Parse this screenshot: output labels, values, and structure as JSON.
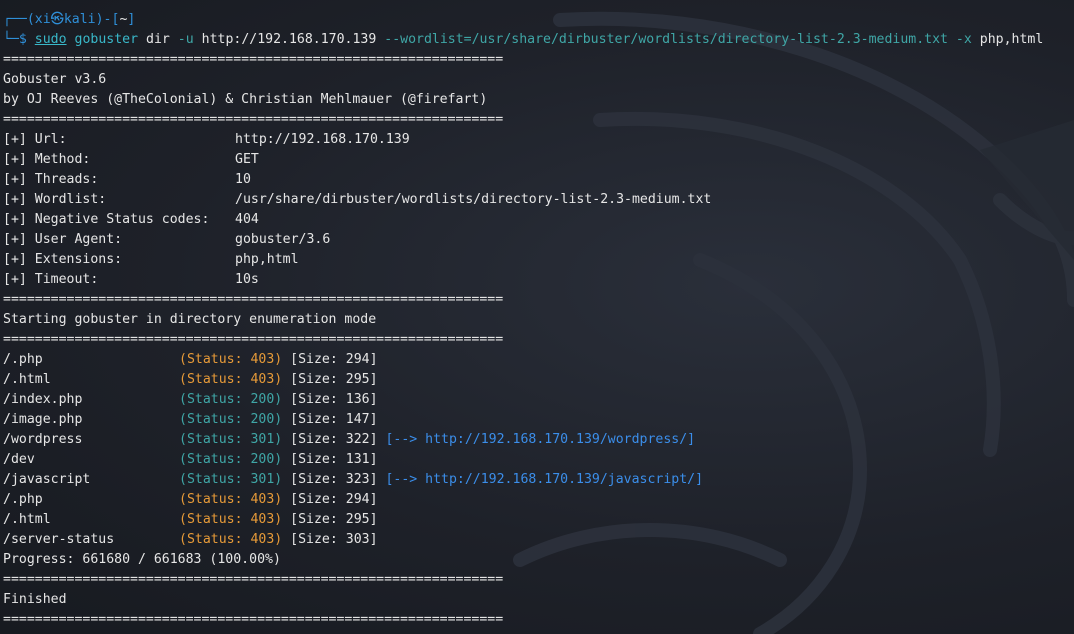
{
  "prompt": {
    "corner_top": "┌──(",
    "user": "xi",
    "skull_glyph": "㉿",
    "host": "kali",
    "sep": ")-[",
    "dir": "~",
    "close": "]",
    "corner_bottom": "└─",
    "dollar": "$",
    "command_sudo": "sudo",
    "command_gobuster": "gobuster",
    "command_dir": "dir",
    "command_flag_u": "-u",
    "command_url": "http://192.168.170.139",
    "command_wordlist_flag": "--wordlist=",
    "command_wordlist_path": "/usr/share/dirbuster/wordlists/directory-list-2.3-medium.txt",
    "command_flag_x": "-x",
    "command_ext": "php,html"
  },
  "separator": "===============================================================",
  "banner": {
    "version": "Gobuster v3.6",
    "authors": "by OJ Reeves (@TheColonial) & Christian Mehlmauer (@firefart)"
  },
  "config": [
    {
      "key": "[+] Url:",
      "value": "http://192.168.170.139"
    },
    {
      "key": "[+] Method:",
      "value": "GET"
    },
    {
      "key": "[+] Threads:",
      "value": "10"
    },
    {
      "key": "[+] Wordlist:",
      "value": "/usr/share/dirbuster/wordlists/directory-list-2.3-medium.txt"
    },
    {
      "key": "[+] Negative Status codes:",
      "value": "404"
    },
    {
      "key": "[+] User Agent:",
      "value": "gobuster/3.6"
    },
    {
      "key": "[+] Extensions:",
      "value": "php,html"
    },
    {
      "key": "[+] Timeout:",
      "value": "10s"
    }
  ],
  "start_message": "Starting gobuster in directory enumeration mode",
  "results": [
    {
      "path": "/.php",
      "status": "(Status: 403)",
      "code": 403,
      "size": "[Size: 294]",
      "redirect": ""
    },
    {
      "path": "/.html",
      "status": "(Status: 403)",
      "code": 403,
      "size": "[Size: 295]",
      "redirect": ""
    },
    {
      "path": "/index.php",
      "status": "(Status: 200)",
      "code": 200,
      "size": "[Size: 136]",
      "redirect": ""
    },
    {
      "path": "/image.php",
      "status": "(Status: 200)",
      "code": 200,
      "size": "[Size: 147]",
      "redirect": ""
    },
    {
      "path": "/wordpress",
      "status": "(Status: 301)",
      "code": 301,
      "size": "[Size: 322]",
      "redirect": "[--> http://192.168.170.139/wordpress/]"
    },
    {
      "path": "/dev",
      "status": "(Status: 200)",
      "code": 200,
      "size": "[Size: 131]",
      "redirect": ""
    },
    {
      "path": "/javascript",
      "status": "(Status: 301)",
      "code": 301,
      "size": "[Size: 323]",
      "redirect": "[--> http://192.168.170.139/javascript/]"
    },
    {
      "path": "/.php",
      "status": "(Status: 403)",
      "code": 403,
      "size": "[Size: 294]",
      "redirect": ""
    },
    {
      "path": "/.html",
      "status": "(Status: 403)",
      "code": 403,
      "size": "[Size: 295]",
      "redirect": ""
    },
    {
      "path": "/server-status",
      "status": "(Status: 403)",
      "code": 403,
      "size": "[Size: 303]",
      "redirect": ""
    }
  ],
  "progress": "Progress: 661680 / 661683 (100.00%)",
  "finished": "Finished",
  "colors": {
    "prompt_blue": "#2f8fd8",
    "command_cyan": "#39b8c9",
    "status_ok": "#3fa6a6",
    "status_forbidden": "#e69a38",
    "redirect_link": "#3b8eea"
  }
}
